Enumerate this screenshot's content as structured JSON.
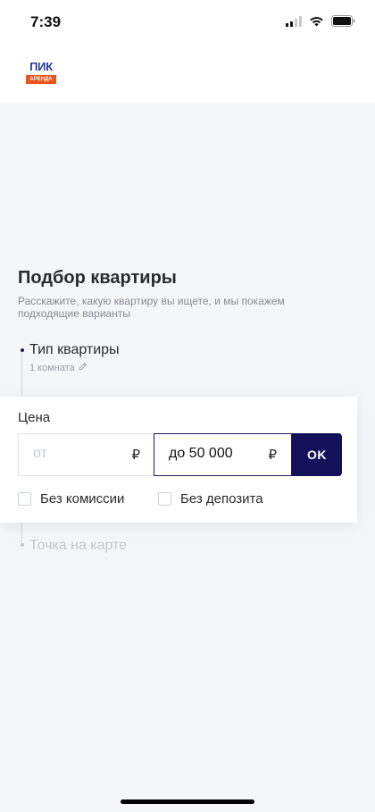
{
  "status_bar": {
    "time": "7:39",
    "icons": [
      "signal-icon",
      "wifi-icon",
      "battery-icon"
    ]
  },
  "header": {
    "logo": {
      "top": "ПИК",
      "bottom": "АРЕНДА"
    }
  },
  "main": {
    "title": "Подбор квартиры",
    "subtitle": "Расскажите, какую квартиру вы ищете, и мы покажем подходящие варианты",
    "steps": [
      {
        "title": "Тип квартиры",
        "value": "1 комната",
        "edit_icon": "pencil-icon"
      },
      {
        "title": "Точка на карте"
      }
    ]
  },
  "price_filter": {
    "label": "Цена",
    "from_placeholder": "от",
    "from_currency": "₽",
    "to_value": "до 50 000",
    "to_currency": "₽",
    "ok_label": "OK",
    "checkboxes": [
      {
        "label": "Без комиссии",
        "checked": false
      },
      {
        "label": "Без депозита",
        "checked": false
      }
    ]
  },
  "colors": {
    "accent": "#14105a",
    "brand_orange": "#e8541c",
    "brand_blue": "#2a3f96"
  }
}
